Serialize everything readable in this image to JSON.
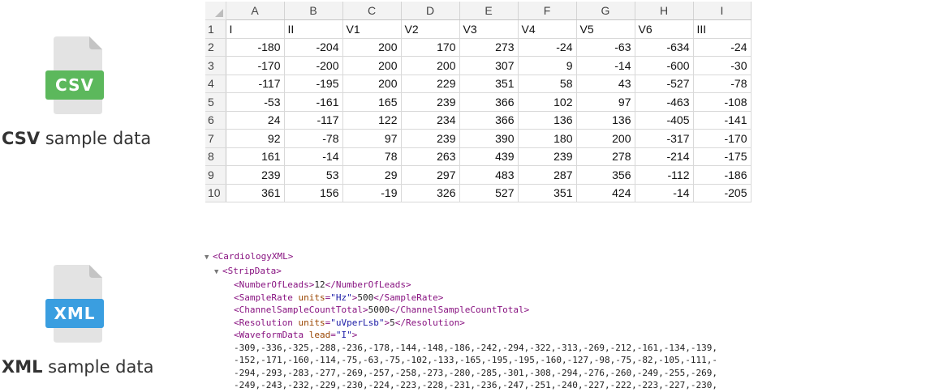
{
  "csv_section": {
    "icon_label": "CSV",
    "icon_color": "#5cb85c",
    "caption_bold": "CSV",
    "caption_rest": " sample data"
  },
  "xml_section": {
    "icon_label": "XML",
    "icon_color": "#3a9ee0",
    "caption_bold": "XML",
    "caption_rest": " sample data"
  },
  "spreadsheet": {
    "columns": [
      "A",
      "B",
      "C",
      "D",
      "E",
      "F",
      "G",
      "H",
      "I"
    ],
    "rows": [
      {
        "n": "1",
        "cells": [
          "I",
          "II",
          "V1",
          "V2",
          "V3",
          "V4",
          "V5",
          "V6",
          "III"
        ]
      },
      {
        "n": "2",
        "cells": [
          "-180",
          "-204",
          "200",
          "170",
          "273",
          "-24",
          "-63",
          "-634",
          "-24"
        ]
      },
      {
        "n": "3",
        "cells": [
          "-170",
          "-200",
          "200",
          "200",
          "307",
          "9",
          "-14",
          "-600",
          "-30"
        ]
      },
      {
        "n": "4",
        "cells": [
          "-117",
          "-195",
          "200",
          "229",
          "351",
          "58",
          "43",
          "-527",
          "-78"
        ]
      },
      {
        "n": "5",
        "cells": [
          "-53",
          "-161",
          "165",
          "239",
          "366",
          "102",
          "97",
          "-463",
          "-108"
        ]
      },
      {
        "n": "6",
        "cells": [
          "24",
          "-117",
          "122",
          "234",
          "366",
          "136",
          "136",
          "-405",
          "-141"
        ]
      },
      {
        "n": "7",
        "cells": [
          "92",
          "-78",
          "97",
          "239",
          "390",
          "180",
          "200",
          "-317",
          "-170"
        ]
      },
      {
        "n": "8",
        "cells": [
          "161",
          "-14",
          "78",
          "263",
          "439",
          "239",
          "278",
          "-214",
          "-175"
        ]
      },
      {
        "n": "9",
        "cells": [
          "239",
          "53",
          "29",
          "297",
          "483",
          "287",
          "356",
          "-112",
          "-186"
        ]
      },
      {
        "n": "10",
        "cells": [
          "361",
          "156",
          "-19",
          "326",
          "527",
          "351",
          "424",
          "-14",
          "-205"
        ]
      }
    ]
  },
  "xml_view": {
    "root_tag": "CardiologyXML",
    "strip_tag": "StripData",
    "lines": [
      {
        "tag": "NumberOfLeads",
        "attr": "",
        "attr_val": "",
        "value": "12"
      },
      {
        "tag": "SampleRate",
        "attr": "units",
        "attr_val": "\"Hz\"",
        "value": "500"
      },
      {
        "tag": "ChannelSampleCountTotal",
        "attr": "",
        "attr_val": "",
        "value": "5000"
      },
      {
        "tag": "Resolution",
        "attr": "units",
        "attr_val": "\"uVperLsb\"",
        "value": "5"
      }
    ],
    "waveform_tag": "WaveformData",
    "waveform_attr": "lead",
    "waveform_attr_val": "\"I\"",
    "waveform_values": [
      "-309,-336,-325,-288,-236,-178,-144,-148,-186,-242,-294,-322,-313,-269,-212,-161,-134,-139,",
      "-152,-171,-160,-114,-75,-63,-75,-102,-133,-165,-195,-195,-160,-127,-98,-75,-82,-105,-111,-",
      "-294,-293,-283,-277,-269,-257,-258,-273,-280,-285,-301,-308,-294,-276,-260,-249,-255,-269,",
      "-249,-243,-232,-229,-230,-224,-223,-228,-231,-236,-247,-251,-240,-227,-222,-223,-227,-230,"
    ]
  }
}
